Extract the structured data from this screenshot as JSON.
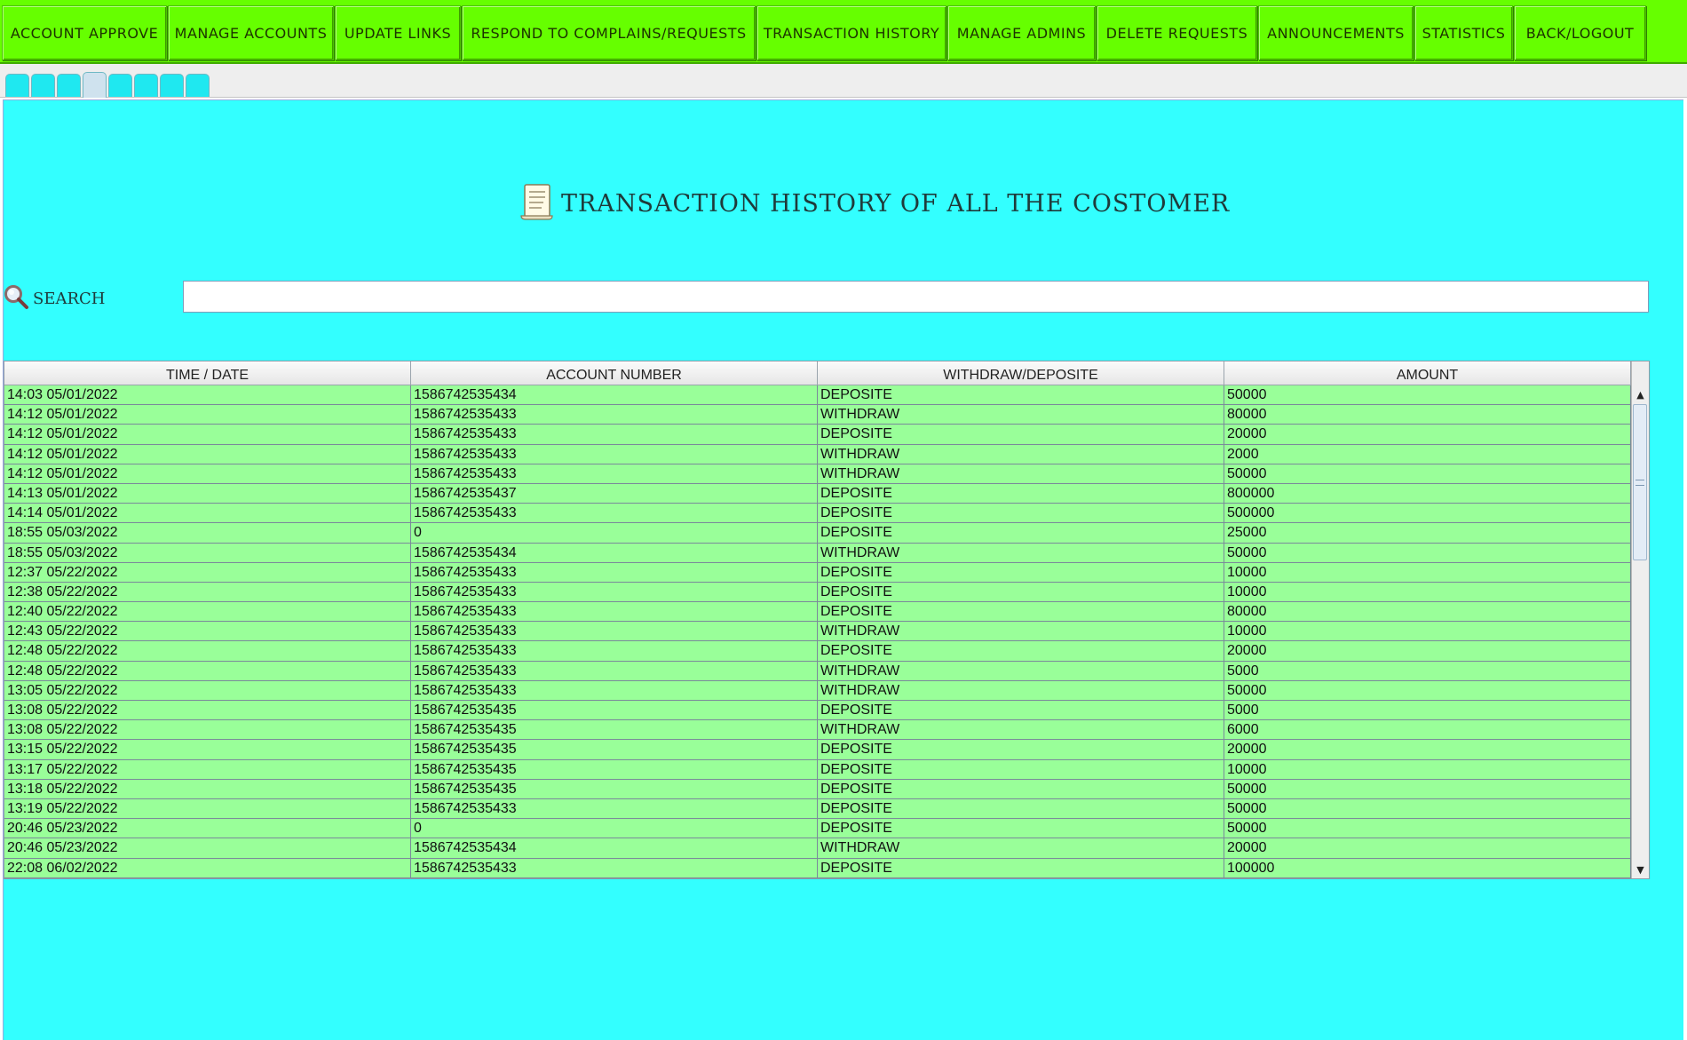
{
  "nav": {
    "items": [
      {
        "label": "ACCOUNT APPROVE"
      },
      {
        "label": "MANAGE ACCOUNTS"
      },
      {
        "label": "UPDATE LINKS"
      },
      {
        "label": "RESPOND TO COMPLAINS/REQUESTS"
      },
      {
        "label": "TRANSACTION HISTORY"
      },
      {
        "label": "MANAGE ADMINS"
      },
      {
        "label": "DELETE REQUESTS"
      },
      {
        "label": "ANNOUNCEMENTS"
      },
      {
        "label": "STATISTICS"
      },
      {
        "label": "BACK/LOGOUT"
      }
    ]
  },
  "tabs": {
    "count": 8,
    "active_index": 3
  },
  "page": {
    "title": "TRANSACTION HISTORY OF ALL THE COSTOMER"
  },
  "search": {
    "label": "SEARCH",
    "value": ""
  },
  "table": {
    "columns": [
      "TIME / DATE",
      "ACCOUNT NUMBER",
      "WITHDRAW/DEPOSITE",
      "AMOUNT"
    ],
    "rows": [
      [
        "14:03 05/01/2022",
        "1586742535434",
        "DEPOSITE",
        "50000"
      ],
      [
        "14:12 05/01/2022",
        "1586742535433",
        "WITHDRAW",
        "80000"
      ],
      [
        "14:12 05/01/2022",
        "1586742535433",
        "DEPOSITE",
        "20000"
      ],
      [
        "14:12 05/01/2022",
        "1586742535433",
        "WITHDRAW",
        "2000"
      ],
      [
        "14:12 05/01/2022",
        "1586742535433",
        "WITHDRAW",
        "50000"
      ],
      [
        "14:13 05/01/2022",
        "1586742535437",
        "DEPOSITE",
        "800000"
      ],
      [
        "14:14 05/01/2022",
        "1586742535433",
        "DEPOSITE",
        "500000"
      ],
      [
        "18:55 05/03/2022",
        "0",
        "DEPOSITE",
        "25000"
      ],
      [
        "18:55 05/03/2022",
        "1586742535434",
        "WITHDRAW",
        "50000"
      ],
      [
        "12:37 05/22/2022",
        "1586742535433",
        "DEPOSITE",
        "10000"
      ],
      [
        "12:38 05/22/2022",
        "1586742535433",
        "DEPOSITE",
        "10000"
      ],
      [
        "12:40 05/22/2022",
        "1586742535433",
        "DEPOSITE",
        "80000"
      ],
      [
        "12:43 05/22/2022",
        "1586742535433",
        "WITHDRAW",
        "10000"
      ],
      [
        "12:48 05/22/2022",
        "1586742535433",
        "DEPOSITE",
        "20000"
      ],
      [
        "12:48 05/22/2022",
        "1586742535433",
        "WITHDRAW",
        "5000"
      ],
      [
        "13:05 05/22/2022",
        "1586742535433",
        "WITHDRAW",
        "50000"
      ],
      [
        "13:08 05/22/2022",
        "1586742535435",
        "DEPOSITE",
        "5000"
      ],
      [
        "13:08 05/22/2022",
        "1586742535435",
        "WITHDRAW",
        "6000"
      ],
      [
        "13:15 05/22/2022",
        "1586742535435",
        "DEPOSITE",
        "20000"
      ],
      [
        "13:17 05/22/2022",
        "1586742535435",
        "DEPOSITE",
        "10000"
      ],
      [
        "13:18 05/22/2022",
        "1586742535435",
        "DEPOSITE",
        "50000"
      ],
      [
        "13:19 05/22/2022",
        "1586742535433",
        "DEPOSITE",
        "50000"
      ],
      [
        "20:46 05/23/2022",
        "0",
        "DEPOSITE",
        "50000"
      ],
      [
        "20:46 05/23/2022",
        "1586742535434",
        "WITHDRAW",
        "20000"
      ],
      [
        "22:08 06/02/2022",
        "1586742535433",
        "DEPOSITE",
        "100000"
      ]
    ]
  },
  "icons": {
    "title_icon": "receipt-scroll-icon",
    "search_icon": "magnifier-icon",
    "scroll_up": "arrow-up-icon",
    "scroll_down": "arrow-down-icon"
  },
  "colors": {
    "nav_green": "#66ff00",
    "panel_cyan": "#33ffff",
    "row_green": "#99ff99"
  }
}
